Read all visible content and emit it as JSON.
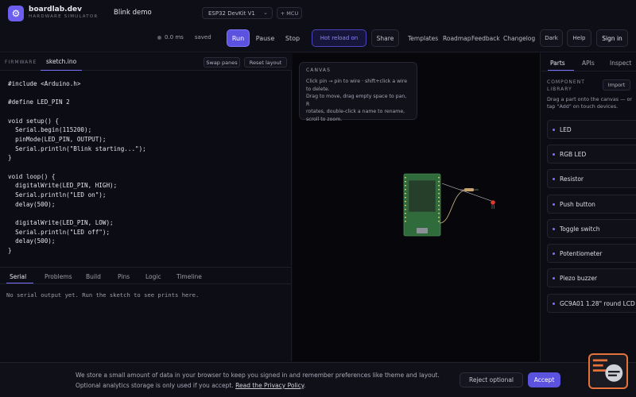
{
  "header": {
    "brand": "boardlab.dev",
    "brand_sub": "HARDWARE SIMULATOR",
    "project_name": "Blink demo",
    "board": "ESP32 DevKit V1",
    "mcu_button": "+ MCU",
    "elapsed": "0.0 ms",
    "save_status": "saved",
    "run": "Run",
    "pause": "Pause",
    "stop": "Stop",
    "hot_reload": "Hot reload on",
    "share": "Share",
    "nav": [
      "Templates",
      "Roadmap",
      "Feedback",
      "Changelog"
    ],
    "theme": "Dark",
    "help": "Help",
    "sign_in": "Sign in"
  },
  "editor": {
    "section_label": "FIRMWARE",
    "file_tab": "sketch.ino",
    "swap_panes": "Swap panes",
    "reset_layout": "Reset layout",
    "code": "#include <Arduino.h>\n\n#define LED_PIN 2\n\nvoid setup() {\n  Serial.begin(115200);\n  pinMode(LED_PIN, OUTPUT);\n  Serial.println(\"Blink starting...\");\n}\n\nvoid loop() {\n  digitalWrite(LED_PIN, HIGH);\n  Serial.println(\"LED on\");\n  delay(500);\n\n  digitalWrite(LED_PIN, LOW);\n  Serial.println(\"LED off\");\n  delay(500);\n}"
  },
  "bottom_panel": {
    "tabs": [
      "Serial",
      "Problems",
      "Build",
      "Pins",
      "Logic",
      "Timeline"
    ],
    "active_tab": "Serial",
    "serial_message": "No serial output yet. Run the sketch to see prints here."
  },
  "canvas": {
    "title": "CANVAS",
    "hint_lines": [
      "Click pin → pin to wire · shift+click a wire",
      "to delete.",
      "Drag to move, drag empty space to pan, R",
      "rotates, double-click a name to rename,",
      "scroll to zoom."
    ]
  },
  "right_panel": {
    "tabs": [
      "Parts",
      "APIs",
      "Inspect"
    ],
    "active_tab": "Parts",
    "library_title": "COMPONENT LIBRARY",
    "import": "Import",
    "description": "Drag a part onto the canvas — or tap \"Add\" on touch devices.",
    "parts": [
      "LED",
      "RGB LED",
      "Resistor",
      "Push button",
      "Toggle switch",
      "Potentiometer",
      "Piezo buzzer",
      "GC9A01 1.28\" round LCD"
    ]
  },
  "cookie_banner": {
    "line1": "We store a small amount of data in your browser to keep you signed in and remember preferences like theme and layout.",
    "line2": "Optional analytics storage is only used if you accept.",
    "link": "Read the Privacy Policy",
    "reject": "Reject optional",
    "accept": "Accept"
  },
  "colors": {
    "accent": "#5b52e0",
    "background": "#0b0b12",
    "board_green": "#2f6b3b",
    "led_red": "#e0392f",
    "support_orange": "#e5723a"
  },
  "icons": [
    "logo-chip-icon",
    "chevron-down-icon",
    "status-dot-icon",
    "support-chat-icon"
  ]
}
